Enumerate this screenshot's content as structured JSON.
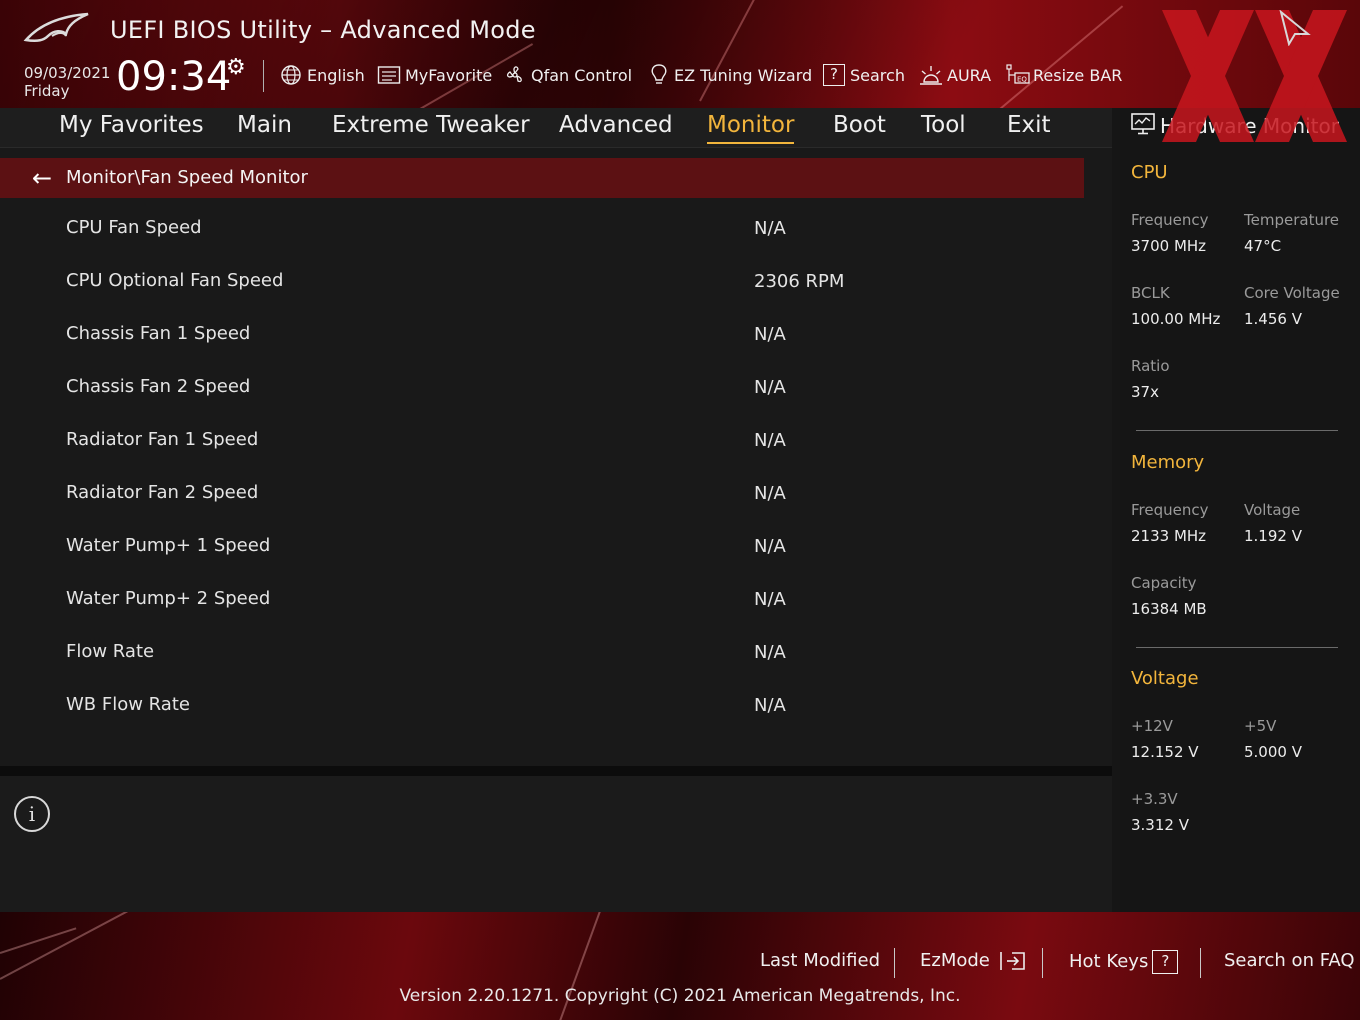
{
  "header": {
    "title": "UEFI BIOS Utility – Advanced Mode",
    "date": "09/03/2021",
    "day": "Friday",
    "time": "09:34",
    "toolbar": [
      {
        "label": "English",
        "icon": "globe-icon"
      },
      {
        "label": "MyFavorite",
        "icon": "favorite-list-icon"
      },
      {
        "label": "Qfan Control",
        "icon": "fan-icon"
      },
      {
        "label": "EZ Tuning Wizard",
        "icon": "lightbulb-icon"
      },
      {
        "label": "Search",
        "icon": "question-box-icon"
      },
      {
        "label": "AURA",
        "icon": "aura-icon"
      },
      {
        "label": "Resize BAR",
        "icon": "resize-bar-icon"
      }
    ]
  },
  "tabs": [
    {
      "label": "My Favorites",
      "active": false
    },
    {
      "label": "Main",
      "active": false
    },
    {
      "label": "Extreme Tweaker",
      "active": false
    },
    {
      "label": "Advanced",
      "active": false
    },
    {
      "label": "Monitor",
      "active": true
    },
    {
      "label": "Boot",
      "active": false
    },
    {
      "label": "Tool",
      "active": false
    },
    {
      "label": "Exit",
      "active": false
    }
  ],
  "breadcrumb": "Monitor\\Fan Speed Monitor",
  "rows": [
    {
      "label": "CPU Fan Speed",
      "value": "N/A"
    },
    {
      "label": "CPU Optional Fan Speed",
      "value": "2306 RPM"
    },
    {
      "label": "Chassis Fan 1 Speed",
      "value": "N/A"
    },
    {
      "label": "Chassis Fan 2 Speed",
      "value": "N/A"
    },
    {
      "label": "Radiator Fan 1 Speed",
      "value": "N/A"
    },
    {
      "label": "Radiator Fan 2 Speed",
      "value": "N/A"
    },
    {
      "label": "Water Pump+ 1 Speed",
      "value": "N/A"
    },
    {
      "label": "Water Pump+ 2 Speed",
      "value": "N/A"
    },
    {
      "label": "Flow Rate",
      "value": "N/A"
    },
    {
      "label": "WB Flow Rate",
      "value": "N/A"
    }
  ],
  "hardware_monitor": {
    "title": "Hardware Monitor",
    "cpu": {
      "heading": "CPU",
      "frequency_label": "Frequency",
      "frequency": "3700 MHz",
      "temperature_label": "Temperature",
      "temperature": "47°C",
      "bclk_label": "BCLK",
      "bclk": "100.00 MHz",
      "core_voltage_label": "Core Voltage",
      "core_voltage": "1.456 V",
      "ratio_label": "Ratio",
      "ratio": "37x"
    },
    "memory": {
      "heading": "Memory",
      "frequency_label": "Frequency",
      "frequency": "2133 MHz",
      "voltage_label": "Voltage",
      "voltage": "1.192 V",
      "capacity_label": "Capacity",
      "capacity": "16384 MB"
    },
    "voltage": {
      "heading": "Voltage",
      "v12_label": "+12V",
      "v12": "12.152 V",
      "v5_label": "+5V",
      "v5": "5.000 V",
      "v33_label": "+3.3V",
      "v33": "3.312 V"
    }
  },
  "footer": {
    "last_modified": "Last Modified",
    "ezmode": "EzMode",
    "hot_keys": "Hot Keys",
    "hot_keys_key": "?",
    "search_faq": "Search on FAQ",
    "version": "Version 2.20.1271. Copyright (C) 2021 American Megatrends, Inc."
  },
  "colors": {
    "accent": "#f2b53c",
    "breadcrumb_bg": "#5c1113",
    "panel_bg": "#191919",
    "brand_red": "#8c0c12"
  }
}
